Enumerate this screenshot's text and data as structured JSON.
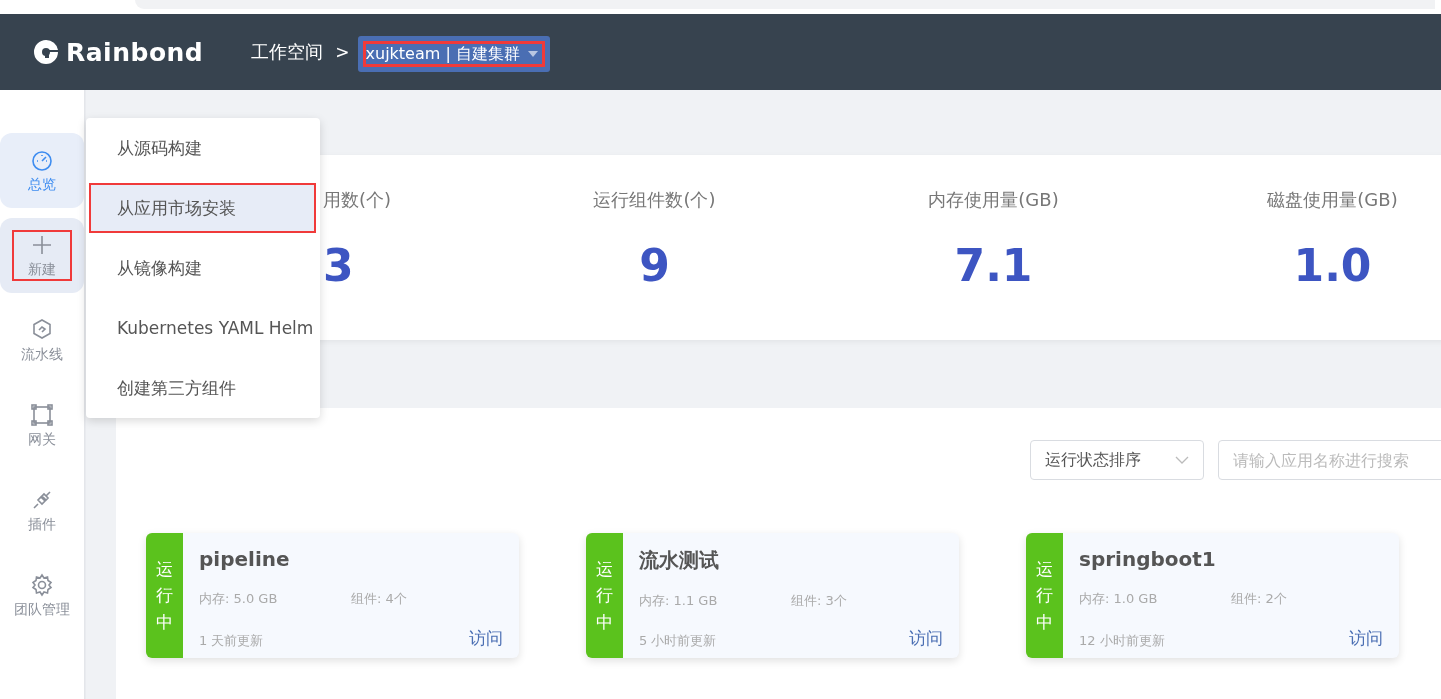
{
  "header": {
    "logo": "Rainbond",
    "breadcrumb": "工作空间",
    "separator": ">",
    "team_selector": {
      "label": "xujkteam | 自建集群",
      "highlighted": true
    }
  },
  "sidebar": {
    "items": [
      {
        "kind": "dashboard",
        "label": "总览",
        "selected": true,
        "expanded": false,
        "highlighted": false
      },
      {
        "kind": "plus",
        "label": "新建",
        "selected": false,
        "expanded": true,
        "highlighted": true
      },
      {
        "kind": "pipeline",
        "label": "流水线",
        "selected": false,
        "expanded": false,
        "highlighted": false
      },
      {
        "kind": "gateway",
        "label": "网关",
        "selected": false,
        "expanded": false,
        "highlighted": false
      },
      {
        "kind": "plugin",
        "label": "插件",
        "selected": false,
        "expanded": false,
        "highlighted": false
      },
      {
        "kind": "gear",
        "label": "团队管理",
        "selected": false,
        "expanded": false,
        "highlighted": false
      }
    ]
  },
  "create_menu": {
    "items": [
      {
        "label": "从源码构建",
        "selected": false,
        "highlighted": false
      },
      {
        "label": "从应用市场安装",
        "selected": true,
        "highlighted": true
      },
      {
        "label": "从镜像构建",
        "selected": false,
        "highlighted": false
      },
      {
        "label": "Kubernetes YAML Helm",
        "selected": false,
        "highlighted": false
      },
      {
        "label": "创建第三方组件",
        "selected": false,
        "highlighted": false
      }
    ]
  },
  "stats": [
    {
      "kind": "cut",
      "label": "用数(个)",
      "value": "3"
    },
    {
      "kind": "full",
      "label": "运行组件数(个)",
      "value": "9"
    },
    {
      "kind": "full",
      "label": "内存使用量(GB)",
      "value": "7.1"
    },
    {
      "kind": "full",
      "label": "磁盘使用量(GB)",
      "value": "1.0"
    }
  ],
  "toolbar": {
    "sort_select": "运行状态排序",
    "search": {
      "placeholder": "请输入应用名称进行搜索"
    }
  },
  "apps": [
    {
      "status": "运行中",
      "name": "pipeline",
      "memory": "内存: 5.0 GB",
      "components": "组件: 4个",
      "updated": "1 天前更新",
      "action": "访问"
    },
    {
      "status": "运行中",
      "name": "流水测试",
      "memory": "内存: 1.1 GB",
      "components": "组件: 3个",
      "updated": "5 小时前更新",
      "action": "访问"
    },
    {
      "status": "运行中",
      "name": "springboot1",
      "memory": "内存: 1.0 GB",
      "components": "组件: 2个",
      "updated": "12 小时前更新",
      "action": "访问"
    }
  ]
}
